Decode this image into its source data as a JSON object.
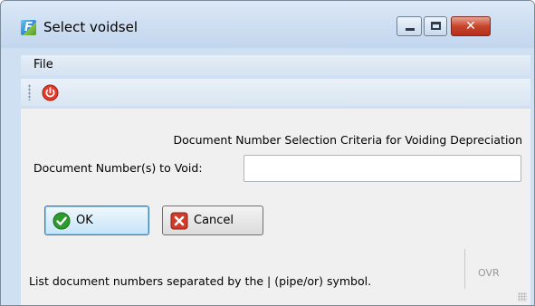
{
  "window": {
    "title": "Select voidsel",
    "app_icon_letter": "F",
    "close_glyph": "✕"
  },
  "menu": {
    "items": [
      {
        "label": "File"
      }
    ]
  },
  "toolbar": {
    "power_icon": "power-icon"
  },
  "form": {
    "criteria_title": "Document Number Selection Criteria for Voiding Depreciation",
    "doc_label": "Document Number(s) to Void:",
    "doc_value": "",
    "doc_placeholder": ""
  },
  "buttons": {
    "ok_label": "OK",
    "cancel_label": "Cancel"
  },
  "status": {
    "hint": "List document numbers separated by the | (pipe/or) symbol.",
    "mode": "OVR"
  },
  "colors": {
    "accent": "#3c7fb1",
    "ok_green": "#2e9b2e",
    "cancel_red": "#d13b2a"
  }
}
